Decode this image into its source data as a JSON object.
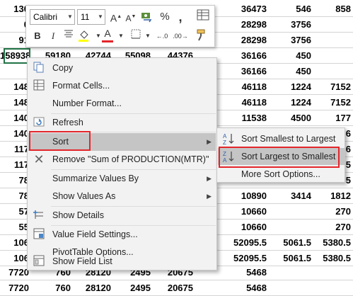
{
  "sheet": {
    "rows": [
      [
        "130",
        "",
        "",
        "",
        "",
        "36473",
        "546",
        "858"
      ],
      [
        "0",
        "",
        "",
        "",
        "",
        "28298",
        "3756",
        ""
      ],
      [
        "91",
        "",
        "",
        "",
        "",
        "28298",
        "3756",
        ""
      ],
      [
        "158938",
        "59180",
        "42744",
        "55098",
        "44376",
        "36166",
        "450",
        ""
      ],
      [
        "",
        "",
        "",
        "",
        "",
        "36166",
        "450",
        ""
      ],
      [
        "148",
        "",
        "",
        "",
        "",
        "46118",
        "1224",
        "7152"
      ],
      [
        "148",
        "",
        "",
        "",
        "",
        "46118",
        "1224",
        "7152"
      ],
      [
        "140",
        "",
        "",
        "",
        "",
        "11538",
        "4500",
        "177"
      ],
      [
        "140",
        "",
        "",
        "",
        "",
        "",
        "",
        "6"
      ],
      [
        "117",
        "",
        "",
        "",
        "",
        "",
        "",
        "6"
      ],
      [
        "117",
        "",
        "",
        "",
        "",
        "",
        "",
        "5"
      ],
      [
        "78",
        "",
        "",
        "",
        "",
        "",
        "",
        "5"
      ],
      [
        "78",
        "",
        "",
        "",
        "",
        "10890",
        "3414",
        "1812"
      ],
      [
        "57",
        "",
        "",
        "",
        "",
        "10660",
        "",
        "270"
      ],
      [
        "55",
        "",
        "",
        "",
        "",
        "10660",
        "",
        "270"
      ],
      [
        "106",
        "",
        "",
        "",
        "",
        "52095.5",
        "5061.5",
        "5380.5"
      ],
      [
        "106",
        "",
        "",
        "",
        "",
        "52095.5",
        "5061.5",
        "5380.5"
      ],
      [
        "7720",
        "760",
        "28120",
        "2495",
        "20675",
        "5468",
        "",
        ""
      ],
      [
        "7720",
        "760",
        "28120",
        "2495",
        "20675",
        "5468",
        "",
        ""
      ]
    ]
  },
  "mini_toolbar": {
    "font_name": "Calibri",
    "font_size": "11",
    "icons": [
      "grow-font-icon",
      "shrink-font-icon",
      "number-format-icon",
      "percent-icon",
      "comma-style-icon",
      "table-format-icon",
      "bold-icon",
      "italic-icon",
      "align-center-icon",
      "fill-color-icon",
      "font-color-icon",
      "borders-icon",
      "increase-decimal-icon",
      "decrease-decimal-icon",
      "format-painter-icon"
    ],
    "bold": "B",
    "italic": "I",
    "percent": "%",
    "comma": ",",
    "grow": "A",
    "shrink": "A",
    "font_color_letter": "A",
    "inc_decimal": "←.0",
    "dec_decimal": ".00→"
  },
  "context_menu": {
    "items": {
      "copy": "Copy",
      "format_cells": "Format Cells...",
      "number_format": "Number Format...",
      "refresh": "Refresh",
      "sort": "Sort",
      "remove": "Remove \"Sum of PRODUCTION(MTR)\"",
      "summarize": "Summarize Values By",
      "show_values": "Show Values As",
      "show_details": "Show Details",
      "value_field_settings": "Value Field Settings...",
      "pivottable_options": "PivotTable Options...",
      "show_field_list": "Show Field List"
    }
  },
  "submenu": {
    "sort_asc": "Sort Smallest to Largest",
    "sort_desc": "Sort Largest to Smallest",
    "more": "More Sort Options...",
    "asc_icon_top": "A",
    "asc_icon_bottom": "Z",
    "desc_icon_top": "Z",
    "desc_icon_bottom": "A"
  },
  "colors": {
    "highlight_box": "#e3262b",
    "selection_border": "#217346",
    "font_color_bar": "#e3262b",
    "fill_color_bar": "#ffff00"
  }
}
